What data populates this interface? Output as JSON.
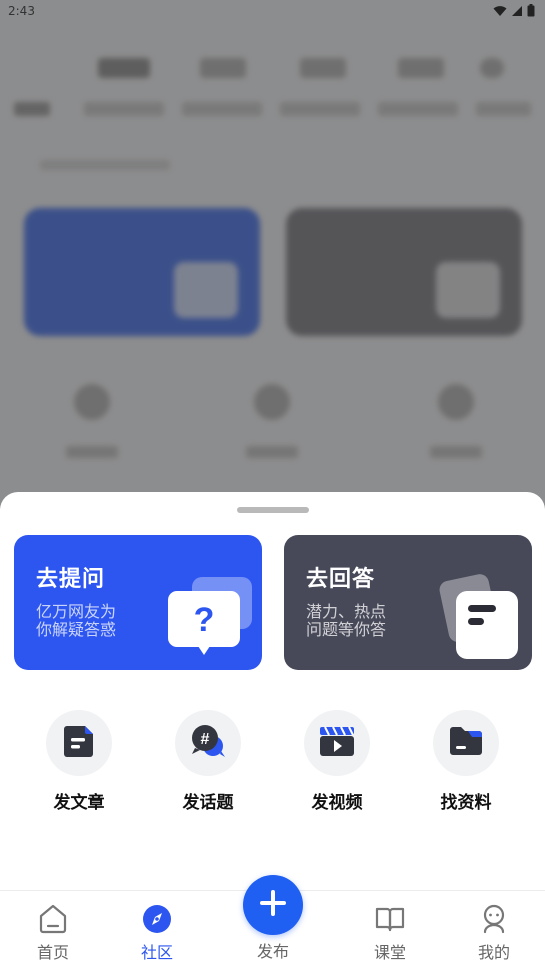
{
  "status_bar": {
    "time": "2:43",
    "icons": [
      "wifi-icon",
      "signal-icon",
      "battery-icon"
    ]
  },
  "sheet": {
    "ask_card": {
      "title": "去提问",
      "subtitle_line1": "亿万网友为",
      "subtitle_line2": "你解疑答惑",
      "icon": "question-bubble-icon",
      "color": "#2d56f0"
    },
    "answer_card": {
      "title": "去回答",
      "subtitle_line1": "潜力、热点",
      "subtitle_line2": "问题等你答",
      "icon": "answer-note-icon",
      "color": "#474959"
    },
    "actions": [
      {
        "label": "发文章",
        "icon": "article-icon"
      },
      {
        "label": "发话题",
        "icon": "topic-hashtag-icon"
      },
      {
        "label": "发视频",
        "icon": "video-clapper-icon"
      },
      {
        "label": "找资料",
        "icon": "folder-icon"
      }
    ]
  },
  "tabbar": {
    "items": [
      {
        "label": "首页",
        "icon": "home-icon",
        "active": false
      },
      {
        "label": "社区",
        "icon": "compass-icon",
        "active": true
      },
      {
        "label": "发布",
        "icon": "plus-icon",
        "active": false
      },
      {
        "label": "课堂",
        "icon": "book-icon",
        "active": false
      },
      {
        "label": "我的",
        "icon": "profile-icon",
        "active": false
      }
    ],
    "accent_color": "#2d56f0"
  }
}
